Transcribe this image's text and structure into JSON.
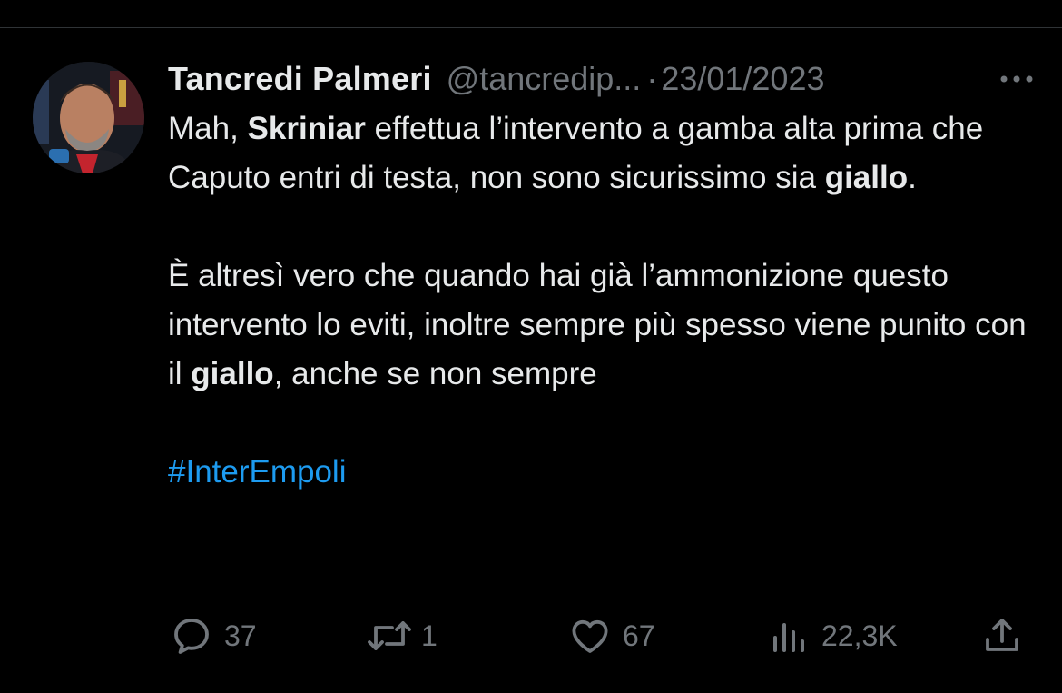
{
  "tweet": {
    "author": {
      "display_name": "Tancredi Palmeri",
      "handle": "@tancredip...",
      "avatar": "profile-photo"
    },
    "separator": "·",
    "date": "23/01/2023",
    "more_icon": "more-horizontal-icon",
    "paragraph1": {
      "t1": "Mah, ",
      "b1": "Skriniar",
      "t2": " effettua l’intervento a gamba alta prima che Caputo entri di testa, non sono sicurissimo sia ",
      "b2": "giallo",
      "t3": "."
    },
    "paragraph2": {
      "t1": "È altresì vero che quando hai già l’ammonizione questo intervento lo eviti, inoltre sempre più spesso viene punito con il ",
      "b1": "giallo",
      "t2": ", anche se non sempre"
    },
    "hashtag": "#InterEmpoli",
    "metrics": {
      "replies": "37",
      "retweets": "1",
      "likes": "67",
      "views": "22,3K"
    },
    "icons": {
      "reply": "reply-icon",
      "retweet": "retweet-icon",
      "like": "heart-icon",
      "views": "views-icon",
      "share": "share-icon"
    }
  },
  "colors": {
    "background": "#000000",
    "text": "#e7e9ea",
    "secondary": "#71767b",
    "link": "#1d9bf0",
    "divider": "#2f3336"
  }
}
